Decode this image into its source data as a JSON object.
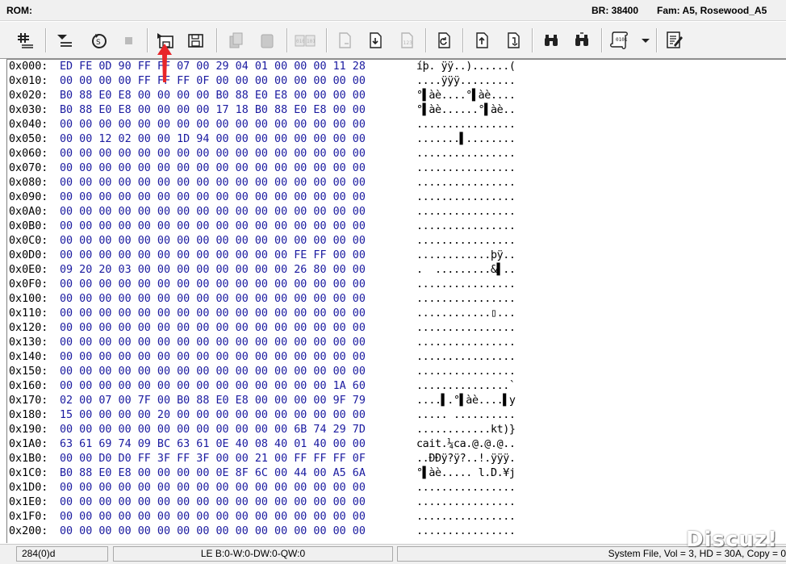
{
  "titlebar": {
    "label": "ROM:",
    "baud": "BR: 38400",
    "family": "Fam: A5, Rosewood_A5"
  },
  "toolbar_icons": [
    "hash-icon",
    "read-icon",
    "verify-icon",
    "stop-icon",
    "load-icon",
    "save-icon",
    "copy-icon",
    "paste-icon",
    "compare-icon",
    "file-icon",
    "download-icon",
    "numbers-icon",
    "refresh-icon",
    "upload-icon",
    "send-icon",
    "find-icon",
    "find-next-icon",
    "script-icon",
    "dropdown-icon",
    "edit-icon"
  ],
  "rows": [
    {
      "addr": "0x000:",
      "bytes": "ED FE 0D 90 FF FF 07 00 29 04 01 00 00 00 11 28",
      "ascii": "íþ. ÿÿ..)......("
    },
    {
      "addr": "0x010:",
      "bytes": "00 00 00 00 FF FF FF 0F 00 00 00 00 00 00 00 00",
      "ascii": "....ÿÿÿ........."
    },
    {
      "addr": "0x020:",
      "bytes": "B0 88 E0 E8 00 00 00 00 B0 88 E0 E8 00 00 00 00",
      "ascii": "°▌àè....°▌àè...."
    },
    {
      "addr": "0x030:",
      "bytes": "B0 88 E0 E8 00 00 00 00 17 18 B0 88 E0 E8 00 00",
      "ascii": "°▌àè......°▌àè.."
    },
    {
      "addr": "0x040:",
      "bytes": "00 00 00 00 00 00 00 00 00 00 00 00 00 00 00 00",
      "ascii": "................"
    },
    {
      "addr": "0x050:",
      "bytes": "00 00 12 02 00 00 1D 94 00 00 00 00 00 00 00 00",
      "ascii": ".......▌........"
    },
    {
      "addr": "0x060:",
      "bytes": "00 00 00 00 00 00 00 00 00 00 00 00 00 00 00 00",
      "ascii": "................"
    },
    {
      "addr": "0x070:",
      "bytes": "00 00 00 00 00 00 00 00 00 00 00 00 00 00 00 00",
      "ascii": "................"
    },
    {
      "addr": "0x080:",
      "bytes": "00 00 00 00 00 00 00 00 00 00 00 00 00 00 00 00",
      "ascii": "................"
    },
    {
      "addr": "0x090:",
      "bytes": "00 00 00 00 00 00 00 00 00 00 00 00 00 00 00 00",
      "ascii": "................"
    },
    {
      "addr": "0x0A0:",
      "bytes": "00 00 00 00 00 00 00 00 00 00 00 00 00 00 00 00",
      "ascii": "................"
    },
    {
      "addr": "0x0B0:",
      "bytes": "00 00 00 00 00 00 00 00 00 00 00 00 00 00 00 00",
      "ascii": "................"
    },
    {
      "addr": "0x0C0:",
      "bytes": "00 00 00 00 00 00 00 00 00 00 00 00 00 00 00 00",
      "ascii": "................"
    },
    {
      "addr": "0x0D0:",
      "bytes": "00 00 00 00 00 00 00 00 00 00 00 00 FE FF 00 00",
      "ascii": "............þÿ.."
    },
    {
      "addr": "0x0E0:",
      "bytes": "09 20 20 03 00 00 00 00 00 00 00 00 26 80 00 00",
      "ascii": ".  .........&▌.."
    },
    {
      "addr": "0x0F0:",
      "bytes": "00 00 00 00 00 00 00 00 00 00 00 00 00 00 00 00",
      "ascii": "................"
    },
    {
      "addr": "0x100:",
      "bytes": "00 00 00 00 00 00 00 00 00 00 00 00 00 00 00 00",
      "ascii": "................"
    },
    {
      "addr": "0x110:",
      "bytes": "00 00 00 00 00 00 00 00 00 00 00 00 00 00 00 00",
      "ascii": "............▯..."
    },
    {
      "addr": "0x120:",
      "bytes": "00 00 00 00 00 00 00 00 00 00 00 00 00 00 00 00",
      "ascii": "................"
    },
    {
      "addr": "0x130:",
      "bytes": "00 00 00 00 00 00 00 00 00 00 00 00 00 00 00 00",
      "ascii": "................"
    },
    {
      "addr": "0x140:",
      "bytes": "00 00 00 00 00 00 00 00 00 00 00 00 00 00 00 00",
      "ascii": "................"
    },
    {
      "addr": "0x150:",
      "bytes": "00 00 00 00 00 00 00 00 00 00 00 00 00 00 00 00",
      "ascii": "................"
    },
    {
      "addr": "0x160:",
      "bytes": "00 00 00 00 00 00 00 00 00 00 00 00 00 00 1A 60",
      "ascii": "...............`"
    },
    {
      "addr": "0x170:",
      "bytes": "02 00 07 00 7F 00 B0 88 E0 E8 00 00 00 00 9F 79",
      "ascii": "....▌.°▌àè....▌y"
    },
    {
      "addr": "0x180:",
      "bytes": "15 00 00 00 00 20 00 00 00 00 00 00 00 00 00 00",
      "ascii": "..... .........."
    },
    {
      "addr": "0x190:",
      "bytes": "00 00 00 00 00 00 00 00 00 00 00 00 6B 74 29 7D",
      "ascii": "............kt)}"
    },
    {
      "addr": "0x1A0:",
      "bytes": "63 61 69 74 09 BC 63 61 0E 40 08 40 01 40 00 00",
      "ascii": "cait.¼ca.@.@.@.."
    },
    {
      "addr": "0x1B0:",
      "bytes": "00 00 D0 D0 FF 3F FF 3F 00 00 21 00 FF FF FF 0F",
      "ascii": "..ÐÐÿ?ÿ?..!.ÿÿÿ."
    },
    {
      "addr": "0x1C0:",
      "bytes": "B0 88 E0 E8 00 00 00 00 0E 8F 6C 00 44 00 A5 6A",
      "ascii": "°▌àè..... l.D.¥j"
    },
    {
      "addr": "0x1D0:",
      "bytes": "00 00 00 00 00 00 00 00 00 00 00 00 00 00 00 00",
      "ascii": "................"
    },
    {
      "addr": "0x1E0:",
      "bytes": "00 00 00 00 00 00 00 00 00 00 00 00 00 00 00 00",
      "ascii": "................"
    },
    {
      "addr": "0x1F0:",
      "bytes": "00 00 00 00 00 00 00 00 00 00 00 00 00 00 00 00",
      "ascii": "................"
    },
    {
      "addr": "0x200:",
      "bytes": "00 00 00 00 00 00 00 00 00 00 00 00 00 00 00 00",
      "ascii": "................"
    }
  ],
  "status": {
    "position": "284(0)d",
    "mode": "LE B:0-W:0-DW:0-QW:0",
    "file": "System File, Vol = 3, HD = 30A, Copy = 0"
  },
  "watermark": "Discuz!",
  "colors": {
    "bytes": "#1a1aa0",
    "arrow": "#e8262a"
  }
}
